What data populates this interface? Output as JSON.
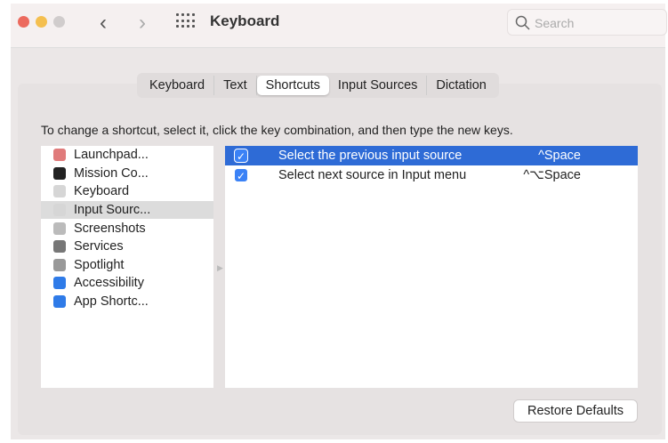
{
  "window": {
    "title": "Keyboard",
    "search_placeholder": "Search"
  },
  "tabs": [
    "Keyboard",
    "Text",
    "Shortcuts",
    "Input Sources",
    "Dictation"
  ],
  "selected_tab": "Shortcuts",
  "instruction": "To change a shortcut, select it, click the key combination, and then type the new keys.",
  "categories": [
    {
      "label": "Launchpad...",
      "icon": "launchpad-icon",
      "color": "#e07b7b"
    },
    {
      "label": "Mission Co...",
      "icon": "mission-control-icon",
      "color": "#222222"
    },
    {
      "label": "Keyboard",
      "icon": "keyboard-icon",
      "color": "#d6d6d6"
    },
    {
      "label": "Input Sourc...",
      "icon": "input-sources-icon",
      "color": "#d6d6d6"
    },
    {
      "label": "Screenshots",
      "icon": "screenshots-icon",
      "color": "#bbbbbb"
    },
    {
      "label": "Services",
      "icon": "gear-icon",
      "color": "#777777"
    },
    {
      "label": "Spotlight",
      "icon": "magnifier-icon",
      "color": "#999999"
    },
    {
      "label": "Accessibility",
      "icon": "accessibility-icon",
      "color": "#2f7be8"
    },
    {
      "label": "App Shortc...",
      "icon": "app-store-icon",
      "color": "#2f7be8"
    }
  ],
  "selected_category": 3,
  "shortcuts": [
    {
      "label": "Select the previous input source",
      "key": "^Space",
      "checked": true
    },
    {
      "label": "Select next source in Input menu",
      "key": "^⌥Space",
      "checked": true
    }
  ],
  "restore_label": "Restore Defaults"
}
